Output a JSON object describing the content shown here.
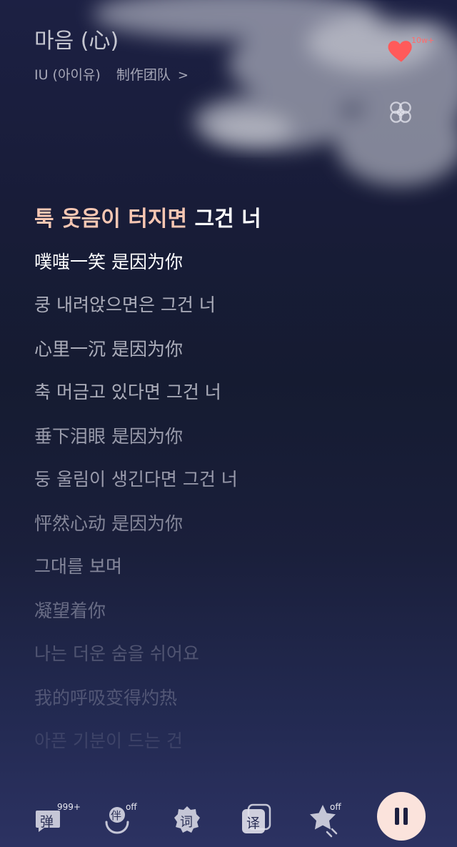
{
  "header": {
    "title": "마음 (心)",
    "artist": "IU (아이유)",
    "credits_link": "制作团队",
    "chevron": ">"
  },
  "side": {
    "like_count": "10w+",
    "like_color": "#ff5a5a"
  },
  "lyrics": {
    "active": {
      "korean_highlighted": "툭 웃음이 터지면",
      "korean_rest": " 그건 너",
      "chinese": "噗嗤一笑 是因为你"
    },
    "lines": [
      {
        "ko": "쿵 내려앉으면은 그건 너",
        "zh": "心里一沉 是因为你"
      },
      {
        "ko": "축 머금고 있다면 그건 너",
        "zh": "垂下泪眼 是因为你"
      },
      {
        "ko": "둥 울림이 생긴다면 그건 너",
        "zh": "怦然心动 是因为你"
      },
      {
        "ko": "그대를 보며",
        "zh": "凝望着你"
      },
      {
        "ko": "나는 더운 숨을 쉬어요",
        "zh": "我的呼吸变得灼热"
      },
      {
        "ko": "아픈 기분이 드는 건",
        "zh": ""
      }
    ]
  },
  "toolbar": {
    "danmu_label": "弹",
    "danmu_badge": "999+",
    "accompany_label": "伴",
    "accompany_badge": "off",
    "lyrics_label": "词",
    "translate_label": "译",
    "star_badge": "off"
  },
  "colors": {
    "highlight": "#f8c7b3",
    "pause_bg": "#fbe3dc"
  }
}
